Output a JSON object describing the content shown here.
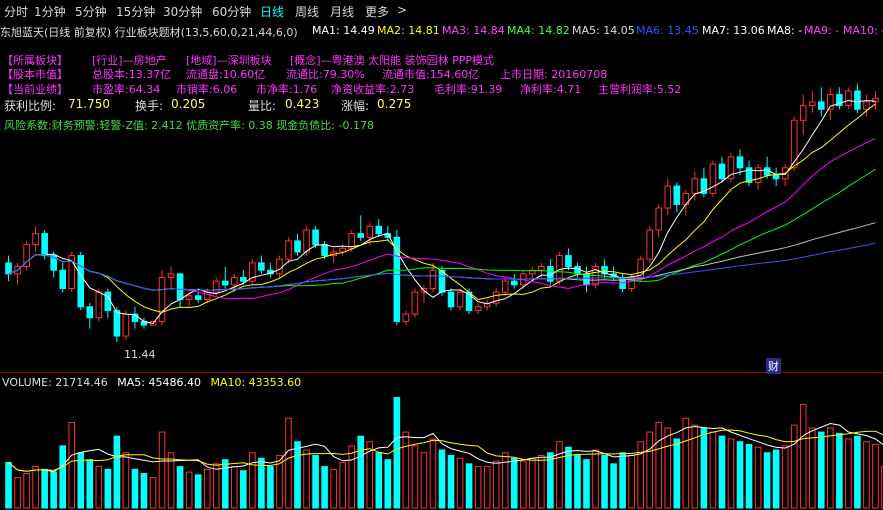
{
  "toolbar": {
    "items": [
      {
        "label": "分时",
        "active": false
      },
      {
        "label": "1分钟",
        "active": false
      },
      {
        "label": "5分钟",
        "active": false
      },
      {
        "label": "15分钟",
        "active": false
      },
      {
        "label": "30分钟",
        "active": false
      },
      {
        "label": "60分钟",
        "active": false
      },
      {
        "label": "日线",
        "active": true
      },
      {
        "label": "周线",
        "active": false
      },
      {
        "label": "月线",
        "active": false
      },
      {
        "label": "更多",
        "active": false
      }
    ],
    "more_arrow": ">"
  },
  "ma_bar": {
    "title": "东旭蓝天(日线 前复权) 行业板块题材(13,5,60,0,21,44,6,0)",
    "ma1": "MA1: 14.49",
    "ma2": "MA2: 14.81",
    "ma3": "MA3: 14.84",
    "ma4": "MA4: 14.82",
    "ma5": "MA5: 14.05",
    "ma6": "MA6: 13.45",
    "ma7": "MA7: 13.06",
    "ma8": "MA8: -",
    "ma9": "MA9: -",
    "ma10": "MA10: -"
  },
  "info": {
    "row1": [
      "【所属板块】",
      "[行业]—房地产",
      "[地域]—深圳板块",
      "[概念]—粤港澳 太阳能 装饰园林 PPP模式"
    ],
    "row2": [
      "【股本市值】",
      "总股本:13.37亿",
      "流通盘:10.60亿",
      "流通比:79.30%",
      "流通市值:154.60亿",
      "上市日期: 20160708"
    ],
    "row3": [
      "【当前业绩】",
      "市盈率:64.34",
      "市销率:6.06",
      "市净率:1.76",
      "净资收益率:2.73",
      "毛利率:91.39",
      "净利率:4.71",
      "主营利润率:5.52"
    ],
    "row4": [
      "获利比例:",
      "71.750",
      "换手:",
      "0.205",
      "量比:",
      "0.423",
      "涨幅:",
      "0.275"
    ],
    "row5": "风险系数:财务预警:轻警-Z值: 2.412 优质资产率: 0.38 现金负债比: -0.178"
  },
  "price_chart": {
    "low_label": "11.44",
    "finance_badge": "财"
  },
  "volume": {
    "label": "VOLUME: 21714.46",
    "ma5": "MA5: 45486.40",
    "ma10": "MA10: 43353.60"
  },
  "colors": {
    "up": "#ff3232",
    "down": "#00ffff",
    "ma1": "#ffffff",
    "ma2": "#ffff00",
    "ma3": "#ff00ff",
    "ma4": "#00ff00",
    "ma5": "#c0c0c0",
    "ma6": "#3355ff",
    "ma7": "#ffffff"
  },
  "chart_data": {
    "type": "candlestick",
    "candles": [
      {
        "o": 13.6,
        "h": 13.8,
        "l": 13.1,
        "c": 13.3
      },
      {
        "o": 13.3,
        "h": 13.6,
        "l": 13.0,
        "c": 13.5
      },
      {
        "o": 13.5,
        "h": 14.2,
        "l": 13.4,
        "c": 14.1
      },
      {
        "o": 14.1,
        "h": 14.6,
        "l": 13.9,
        "c": 14.4
      },
      {
        "o": 14.4,
        "h": 14.5,
        "l": 13.7,
        "c": 13.8
      },
      {
        "o": 13.8,
        "h": 13.9,
        "l": 13.2,
        "c": 13.4
      },
      {
        "o": 13.4,
        "h": 13.6,
        "l": 12.8,
        "c": 12.9
      },
      {
        "o": 12.9,
        "h": 13.9,
        "l": 12.8,
        "c": 13.8
      },
      {
        "o": 13.8,
        "h": 13.9,
        "l": 12.3,
        "c": 12.4
      },
      {
        "o": 12.4,
        "h": 12.5,
        "l": 11.8,
        "c": 12.1
      },
      {
        "o": 12.1,
        "h": 12.9,
        "l": 12.0,
        "c": 12.8
      },
      {
        "o": 12.8,
        "h": 12.9,
        "l": 12.1,
        "c": 12.3
      },
      {
        "o": 12.3,
        "h": 12.4,
        "l": 11.44,
        "c": 11.6
      },
      {
        "o": 11.6,
        "h": 12.3,
        "l": 11.5,
        "c": 12.2
      },
      {
        "o": 12.2,
        "h": 12.4,
        "l": 11.8,
        "c": 12.0
      },
      {
        "o": 12.0,
        "h": 12.1,
        "l": 11.8,
        "c": 11.9
      },
      {
        "o": 11.9,
        "h": 12.0,
        "l": 11.9,
        "c": 12.0
      },
      {
        "o": 12.0,
        "h": 13.4,
        "l": 11.9,
        "c": 13.2
      },
      {
        "o": 13.2,
        "h": 13.5,
        "l": 12.9,
        "c": 13.3
      },
      {
        "o": 13.3,
        "h": 13.3,
        "l": 12.4,
        "c": 12.6
      },
      {
        "o": 12.6,
        "h": 12.8,
        "l": 12.4,
        "c": 12.7
      },
      {
        "o": 12.7,
        "h": 12.8,
        "l": 12.5,
        "c": 12.6
      },
      {
        "o": 12.6,
        "h": 12.9,
        "l": 12.5,
        "c": 12.8
      },
      {
        "o": 12.8,
        "h": 13.2,
        "l": 12.7,
        "c": 13.1
      },
      {
        "o": 13.1,
        "h": 13.5,
        "l": 12.9,
        "c": 13.0
      },
      {
        "o": 13.0,
        "h": 13.3,
        "l": 12.8,
        "c": 13.2
      },
      {
        "o": 13.2,
        "h": 13.4,
        "l": 13.0,
        "c": 13.1
      },
      {
        "o": 13.1,
        "h": 13.7,
        "l": 13.0,
        "c": 13.6
      },
      {
        "o": 13.6,
        "h": 13.8,
        "l": 13.3,
        "c": 13.4
      },
      {
        "o": 13.4,
        "h": 13.6,
        "l": 13.2,
        "c": 13.3
      },
      {
        "o": 13.3,
        "h": 13.8,
        "l": 13.2,
        "c": 13.7
      },
      {
        "o": 13.7,
        "h": 14.3,
        "l": 13.6,
        "c": 14.2
      },
      {
        "o": 14.2,
        "h": 14.4,
        "l": 13.8,
        "c": 13.9
      },
      {
        "o": 13.9,
        "h": 14.6,
        "l": 13.8,
        "c": 14.5
      },
      {
        "o": 14.5,
        "h": 14.6,
        "l": 14.0,
        "c": 14.1
      },
      {
        "o": 14.1,
        "h": 14.2,
        "l": 13.7,
        "c": 13.8
      },
      {
        "o": 13.8,
        "h": 14.0,
        "l": 13.6,
        "c": 13.9
      },
      {
        "o": 13.9,
        "h": 14.1,
        "l": 13.8,
        "c": 14.0
      },
      {
        "o": 14.0,
        "h": 14.5,
        "l": 13.9,
        "c": 14.4
      },
      {
        "o": 14.4,
        "h": 14.9,
        "l": 14.2,
        "c": 14.3
      },
      {
        "o": 14.3,
        "h": 14.7,
        "l": 14.1,
        "c": 14.6
      },
      {
        "o": 14.6,
        "h": 14.8,
        "l": 14.3,
        "c": 14.4
      },
      {
        "o": 14.4,
        "h": 14.6,
        "l": 14.2,
        "c": 14.3
      },
      {
        "o": 14.3,
        "h": 14.5,
        "l": 11.9,
        "c": 12.0
      },
      {
        "o": 12.0,
        "h": 12.3,
        "l": 11.9,
        "c": 12.2
      },
      {
        "o": 12.2,
        "h": 12.9,
        "l": 12.1,
        "c": 12.8
      },
      {
        "o": 12.8,
        "h": 13.0,
        "l": 12.5,
        "c": 12.9
      },
      {
        "o": 12.9,
        "h": 13.6,
        "l": 12.8,
        "c": 13.4
      },
      {
        "o": 13.4,
        "h": 13.5,
        "l": 12.7,
        "c": 12.8
      },
      {
        "o": 12.8,
        "h": 12.9,
        "l": 12.3,
        "c": 12.4
      },
      {
        "o": 12.4,
        "h": 12.9,
        "l": 12.3,
        "c": 12.8
      },
      {
        "o": 12.8,
        "h": 12.9,
        "l": 12.2,
        "c": 12.3
      },
      {
        "o": 12.3,
        "h": 12.5,
        "l": 12.2,
        "c": 12.4
      },
      {
        "o": 12.4,
        "h": 12.6,
        "l": 12.3,
        "c": 12.5
      },
      {
        "o": 12.5,
        "h": 12.9,
        "l": 12.4,
        "c": 12.8
      },
      {
        "o": 12.8,
        "h": 13.2,
        "l": 12.7,
        "c": 13.1
      },
      {
        "o": 13.1,
        "h": 13.3,
        "l": 12.9,
        "c": 13.0
      },
      {
        "o": 13.0,
        "h": 13.4,
        "l": 12.9,
        "c": 13.3
      },
      {
        "o": 13.3,
        "h": 13.5,
        "l": 13.1,
        "c": 13.4
      },
      {
        "o": 13.4,
        "h": 13.6,
        "l": 13.2,
        "c": 13.5
      },
      {
        "o": 13.5,
        "h": 13.7,
        "l": 13.0,
        "c": 13.1
      },
      {
        "o": 13.1,
        "h": 13.9,
        "l": 13.0,
        "c": 13.8
      },
      {
        "o": 13.8,
        "h": 14.0,
        "l": 13.4,
        "c": 13.5
      },
      {
        "o": 13.5,
        "h": 13.6,
        "l": 13.2,
        "c": 13.3
      },
      {
        "o": 13.3,
        "h": 13.5,
        "l": 12.8,
        "c": 13.0
      },
      {
        "o": 13.0,
        "h": 13.6,
        "l": 12.9,
        "c": 13.5
      },
      {
        "o": 13.5,
        "h": 13.7,
        "l": 13.2,
        "c": 13.3
      },
      {
        "o": 13.3,
        "h": 13.5,
        "l": 13.1,
        "c": 13.2
      },
      {
        "o": 13.2,
        "h": 13.3,
        "l": 12.8,
        "c": 12.9
      },
      {
        "o": 12.9,
        "h": 13.3,
        "l": 12.8,
        "c": 13.2
      },
      {
        "o": 13.2,
        "h": 13.8,
        "l": 13.1,
        "c": 13.7
      },
      {
        "o": 13.7,
        "h": 14.6,
        "l": 13.6,
        "c": 14.5
      },
      {
        "o": 14.5,
        "h": 15.2,
        "l": 14.3,
        "c": 15.1
      },
      {
        "o": 15.1,
        "h": 15.9,
        "l": 14.9,
        "c": 15.7
      },
      {
        "o": 15.7,
        "h": 15.8,
        "l": 15.0,
        "c": 15.2
      },
      {
        "o": 15.2,
        "h": 15.6,
        "l": 14.9,
        "c": 15.5
      },
      {
        "o": 15.5,
        "h": 16.1,
        "l": 15.3,
        "c": 15.9
      },
      {
        "o": 15.9,
        "h": 16.2,
        "l": 15.4,
        "c": 15.5
      },
      {
        "o": 15.5,
        "h": 16.4,
        "l": 15.4,
        "c": 16.3
      },
      {
        "o": 16.3,
        "h": 16.5,
        "l": 15.8,
        "c": 15.9
      },
      {
        "o": 15.9,
        "h": 16.6,
        "l": 15.8,
        "c": 16.5
      },
      {
        "o": 16.5,
        "h": 16.7,
        "l": 16.0,
        "c": 16.2
      },
      {
        "o": 16.2,
        "h": 16.4,
        "l": 15.7,
        "c": 15.8
      },
      {
        "o": 15.8,
        "h": 16.3,
        "l": 15.6,
        "c": 16.2
      },
      {
        "o": 16.2,
        "h": 16.5,
        "l": 15.9,
        "c": 16.0
      },
      {
        "o": 16.0,
        "h": 16.2,
        "l": 15.7,
        "c": 15.9
      },
      {
        "o": 15.9,
        "h": 16.3,
        "l": 15.7,
        "c": 16.2
      },
      {
        "o": 16.2,
        "h": 17.6,
        "l": 16.1,
        "c": 17.5
      },
      {
        "o": 17.5,
        "h": 18.2,
        "l": 17.1,
        "c": 17.9
      },
      {
        "o": 17.9,
        "h": 18.3,
        "l": 17.7,
        "c": 18.0
      },
      {
        "o": 18.0,
        "h": 18.4,
        "l": 17.6,
        "c": 17.8
      },
      {
        "o": 17.8,
        "h": 18.4,
        "l": 17.5,
        "c": 18.2
      },
      {
        "o": 18.2,
        "h": 18.4,
        "l": 17.8,
        "c": 17.9
      },
      {
        "o": 17.9,
        "h": 18.4,
        "l": 17.8,
        "c": 18.3
      },
      {
        "o": 18.3,
        "h": 18.5,
        "l": 17.7,
        "c": 17.8
      },
      {
        "o": 17.8,
        "h": 18.2,
        "l": 17.6,
        "c": 18.0
      },
      {
        "o": 18.0,
        "h": 18.3,
        "l": 17.8,
        "c": 18.1
      }
    ],
    "volumes": [
      33000,
      22000,
      25000,
      30000,
      28000,
      26000,
      45000,
      62000,
      40000,
      35000,
      30000,
      28000,
      52000,
      40000,
      28000,
      25000,
      22000,
      55000,
      40000,
      30000,
      26000,
      24000,
      28000,
      32000,
      35000,
      30000,
      27000,
      40000,
      36000,
      30000,
      38000,
      65000,
      48000,
      42000,
      38000,
      30000,
      28000,
      33000,
      45000,
      52000,
      48000,
      40000,
      35000,
      80000,
      55000,
      45000,
      40000,
      50000,
      42000,
      38000,
      36000,
      32000,
      30000,
      30000,
      34000,
      40000,
      36000,
      34000,
      36000,
      38000,
      40000,
      48000,
      44000,
      38000,
      35000,
      42000,
      38000,
      32000,
      40000,
      38000,
      48000,
      55000,
      62000,
      58000,
      50000,
      65000,
      60000,
      58000,
      55000,
      52000,
      50000,
      48000,
      46000,
      44000,
      40000,
      42000,
      45000,
      60000,
      75000,
      58000,
      55000,
      58000,
      54000,
      50000,
      52000,
      48000,
      46000,
      30000
    ],
    "ylim": [
      11.0,
      18.6
    ]
  }
}
